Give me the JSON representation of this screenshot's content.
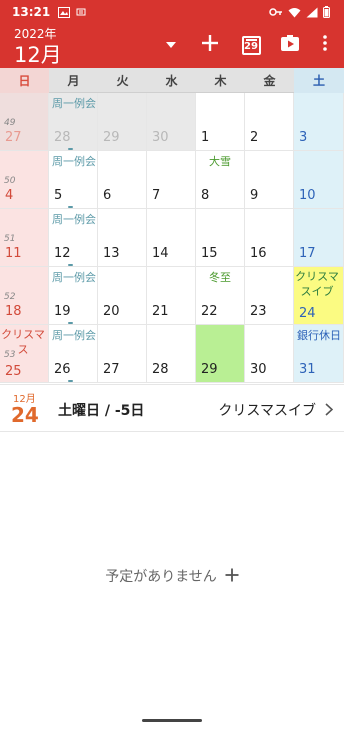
{
  "status_bar": {
    "time": "13:21",
    "icons": [
      "screenshot-icon",
      "app-notification-icon",
      "vpn-key-icon",
      "wifi-icon",
      "signal-icon",
      "battery-icon"
    ]
  },
  "app_bar": {
    "year": "2022年",
    "month": "12月",
    "today_badge": "29",
    "actions": [
      "dropdown-icon",
      "add-icon",
      "today-icon",
      "share-icon",
      "more-icon"
    ]
  },
  "weekdays": [
    "日",
    "月",
    "火",
    "水",
    "木",
    "金",
    "土"
  ],
  "weeks": [
    {
      "week_number": "49",
      "days": [
        {
          "num": "27",
          "other": true
        },
        {
          "num": "28",
          "other": true,
          "event": "周一例会",
          "dot": true
        },
        {
          "num": "29",
          "other": true
        },
        {
          "num": "30",
          "other": true
        },
        {
          "num": "1"
        },
        {
          "num": "2"
        },
        {
          "num": "3"
        }
      ]
    },
    {
      "week_number": "50",
      "days": [
        {
          "num": "4"
        },
        {
          "num": "5",
          "event": "周一例会",
          "dot": true
        },
        {
          "num": "6"
        },
        {
          "num": "7"
        },
        {
          "num": "8",
          "event": "大雪",
          "event_type": "solar"
        },
        {
          "num": "9"
        },
        {
          "num": "10"
        }
      ]
    },
    {
      "week_number": "51",
      "days": [
        {
          "num": "11"
        },
        {
          "num": "12",
          "event": "周一例会",
          "dot": true
        },
        {
          "num": "13"
        },
        {
          "num": "14"
        },
        {
          "num": "15"
        },
        {
          "num": "16"
        },
        {
          "num": "17"
        }
      ]
    },
    {
      "week_number": "52",
      "days": [
        {
          "num": "18"
        },
        {
          "num": "19",
          "event": "周一例会",
          "dot": true
        },
        {
          "num": "20"
        },
        {
          "num": "21"
        },
        {
          "num": "22",
          "event": "冬至",
          "event_type": "solar"
        },
        {
          "num": "23"
        },
        {
          "num": "24",
          "event": "クリスマスイブ",
          "event_type": "wrap",
          "highlight": true
        }
      ]
    },
    {
      "week_number": "53",
      "days": [
        {
          "num": "25",
          "event": "クリスマス",
          "event_type": "holiday-wrap"
        },
        {
          "num": "26",
          "event": "周一例会",
          "dot": true
        },
        {
          "num": "27"
        },
        {
          "num": "28"
        },
        {
          "num": "29",
          "today": true
        },
        {
          "num": "30"
        },
        {
          "num": "31",
          "event": "銀行休日",
          "event_type": "bank"
        }
      ]
    }
  ],
  "selected": {
    "month": "12月",
    "day": "24",
    "weekday": "土曜日 / -5日",
    "holiday": "クリスマスイブ"
  },
  "empty_state": {
    "message": "予定がありません",
    "add_icon": "add-icon"
  },
  "colors": {
    "accent": "#d7342f",
    "sunday": "#d24a3a",
    "saturday": "#2e63b8",
    "today": "#b9ef94",
    "highlight": "#fbfb82"
  }
}
